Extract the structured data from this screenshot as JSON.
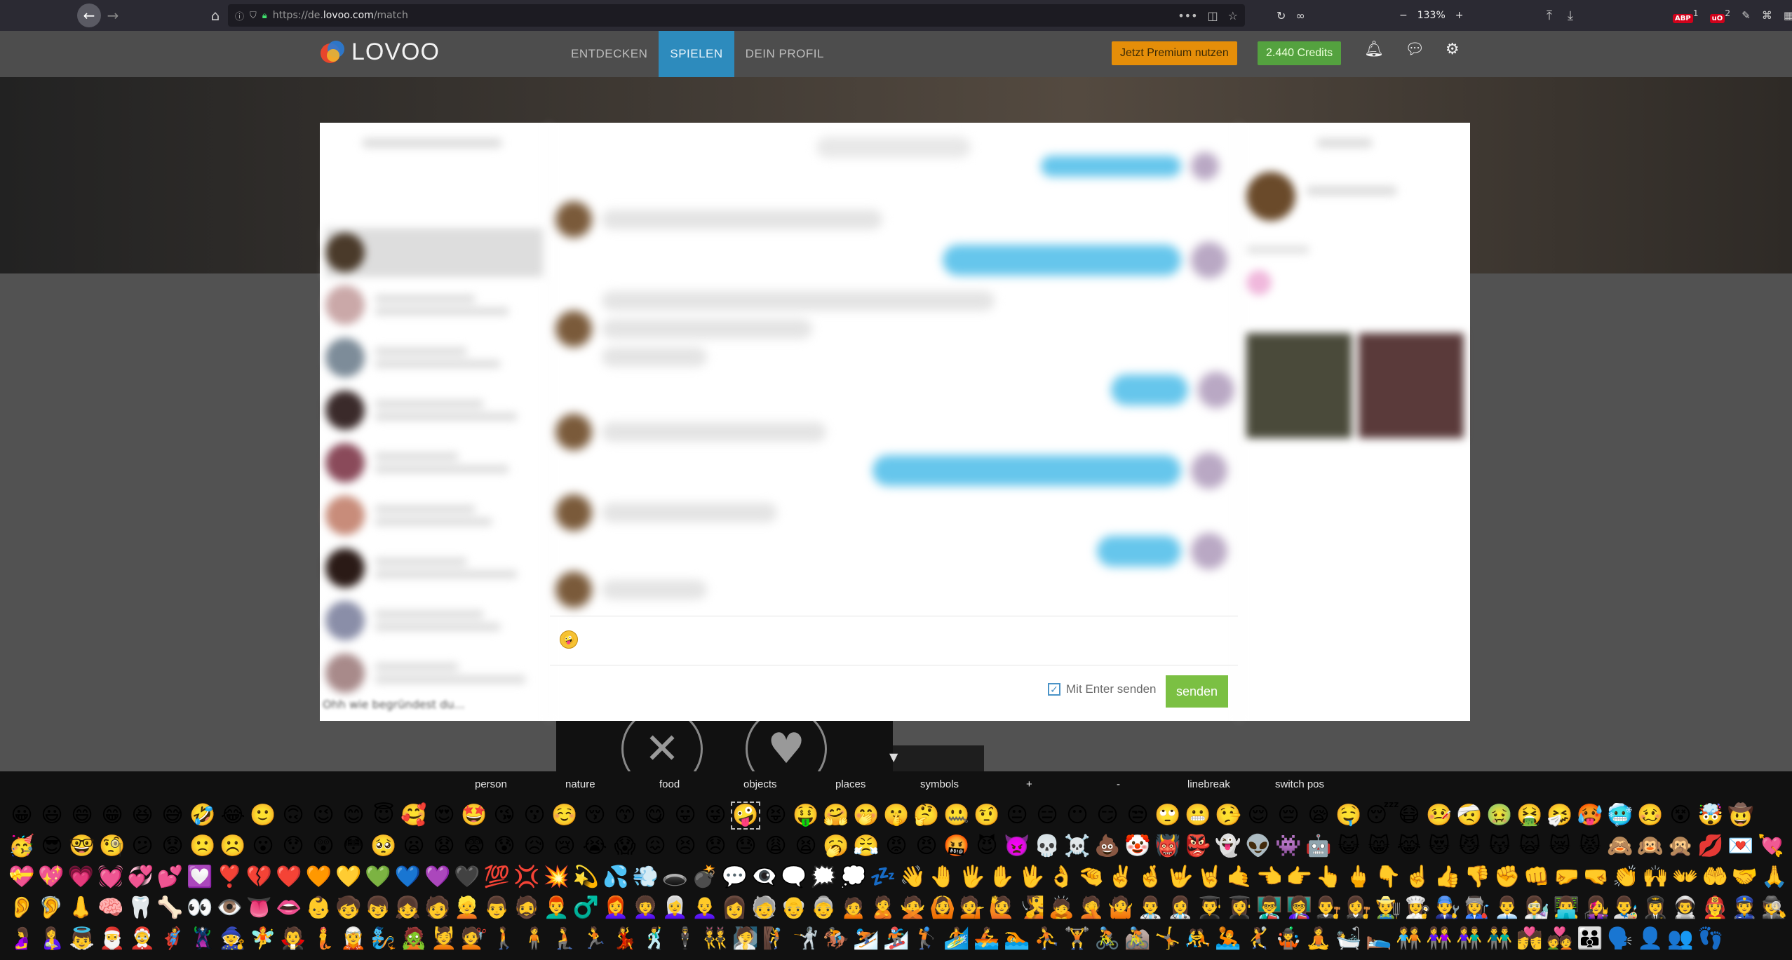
{
  "browser": {
    "url_prefix": "https://de.",
    "url_domain": "lovoo.com",
    "url_path": "/match",
    "zoom": "133%",
    "zoom_minus": "−",
    "zoom_plus": "+",
    "ext_badge_1": "1",
    "ext_badge_2": "2"
  },
  "header": {
    "logo_text": "LOVOO",
    "nav": [
      "ENTDECKEN",
      "SPIELEN",
      "DEIN PROFIL"
    ],
    "active_nav": "SPIELEN",
    "premium_label": "Jetzt Premium nutzen",
    "credits_label": "2.440 Credits"
  },
  "composer": {
    "enter_label": "Mit Enter senden",
    "send_label": "senden"
  },
  "conversation_partial": "Ohh wie begründest du...",
  "emoji_keyboard": {
    "tabs": [
      "person",
      "nature",
      "food",
      "objects",
      "places",
      "symbols",
      "+",
      "-",
      "linebreak",
      "switch pos"
    ],
    "rows": [
      "😀😃😄😁😆😅🤣😂🙂🙃😉😊😇🥰😍🤩😘😗☺️😚😙😋😛😜🤪😝🤑🤗🤭🤫🤔🤐🤨😐😑😶😏😒🙄😬🤥😌😔😪🤤😴😷🤒🤕🤢🤮🤧🥵🥶🥴😵🤯🤠",
      "🥳😎🤓🧐😕😟🙁☹️😮😯😲😳🥺😦😧😨😰😥😢😭😱😖😣😞😓😩😫🥱😤😡😠🤬😈👿💀☠️💩🤡👹👺👻👽👾🤖😺😸😹😻😼😽🙀😿😾🙈🙉🙊💋💌💘",
      "💝💖💗💓💞💕💟❣️💔❤️🧡💛💚💙💜🖤💯💢💥💫💦💨🕳️💣💬👁️‍🗨️🗨️🗯️💭💤👋🤚🖐️✋🖖👌🤏✌️🤞🤟🤘🤙👈👉👆🖕👇☝️👍👎✊👊🤛🤜👏🙌👐🤲🤝🙏✍️💅🤳💪🦾🦵🦿",
      "👂🦻👃🧠🦷🦴👀👁️👅👄👶🧒👦👧🧑👱👨🧔👨‍🦰♂️👩‍🦰👩‍🦱👩‍🦳👩‍🦲👩🧓👴👵🙍🙎🙅🙆💁🙋🧏🙇🤦🤷👨‍⚕️👩‍⚕️👨‍🎓👩‍🎓👨‍🏫👩‍🏫👨‍⚖️👩‍⚖️👨‍🌾👩‍🍳👨‍🔧👩‍🏭👨‍💼👩‍🔬👨‍💻👩‍🎤👨‍🎨👩‍✈️👨‍🚀👩‍🚒👮🕵️💂👷🤴👸👳👲🧕🤵👰",
      "🤰🤱👼🎅🤶🦸🦹🧙🧚🧛🧜🧝🧞🧟💆💇🚶🧍🧎🏃💃🕺🕴️👯🧖🧗🤺🏇⛷️🏂🏌️🏄🚣🏊⛹️🏋️🚴🚵🤸🤼🤽🤾🤹🧘🛀🛌🧑‍🤝‍🧑👭👫👬💏💑👪🗣️👤👥👣"
    ],
    "selected_emoji": "🤪"
  },
  "colors": {
    "nav_active": "#2d8bbd",
    "premium": "#e58e09",
    "credits": "#54a23f",
    "send": "#7bc043",
    "bubble_out": "#66c6ec"
  }
}
